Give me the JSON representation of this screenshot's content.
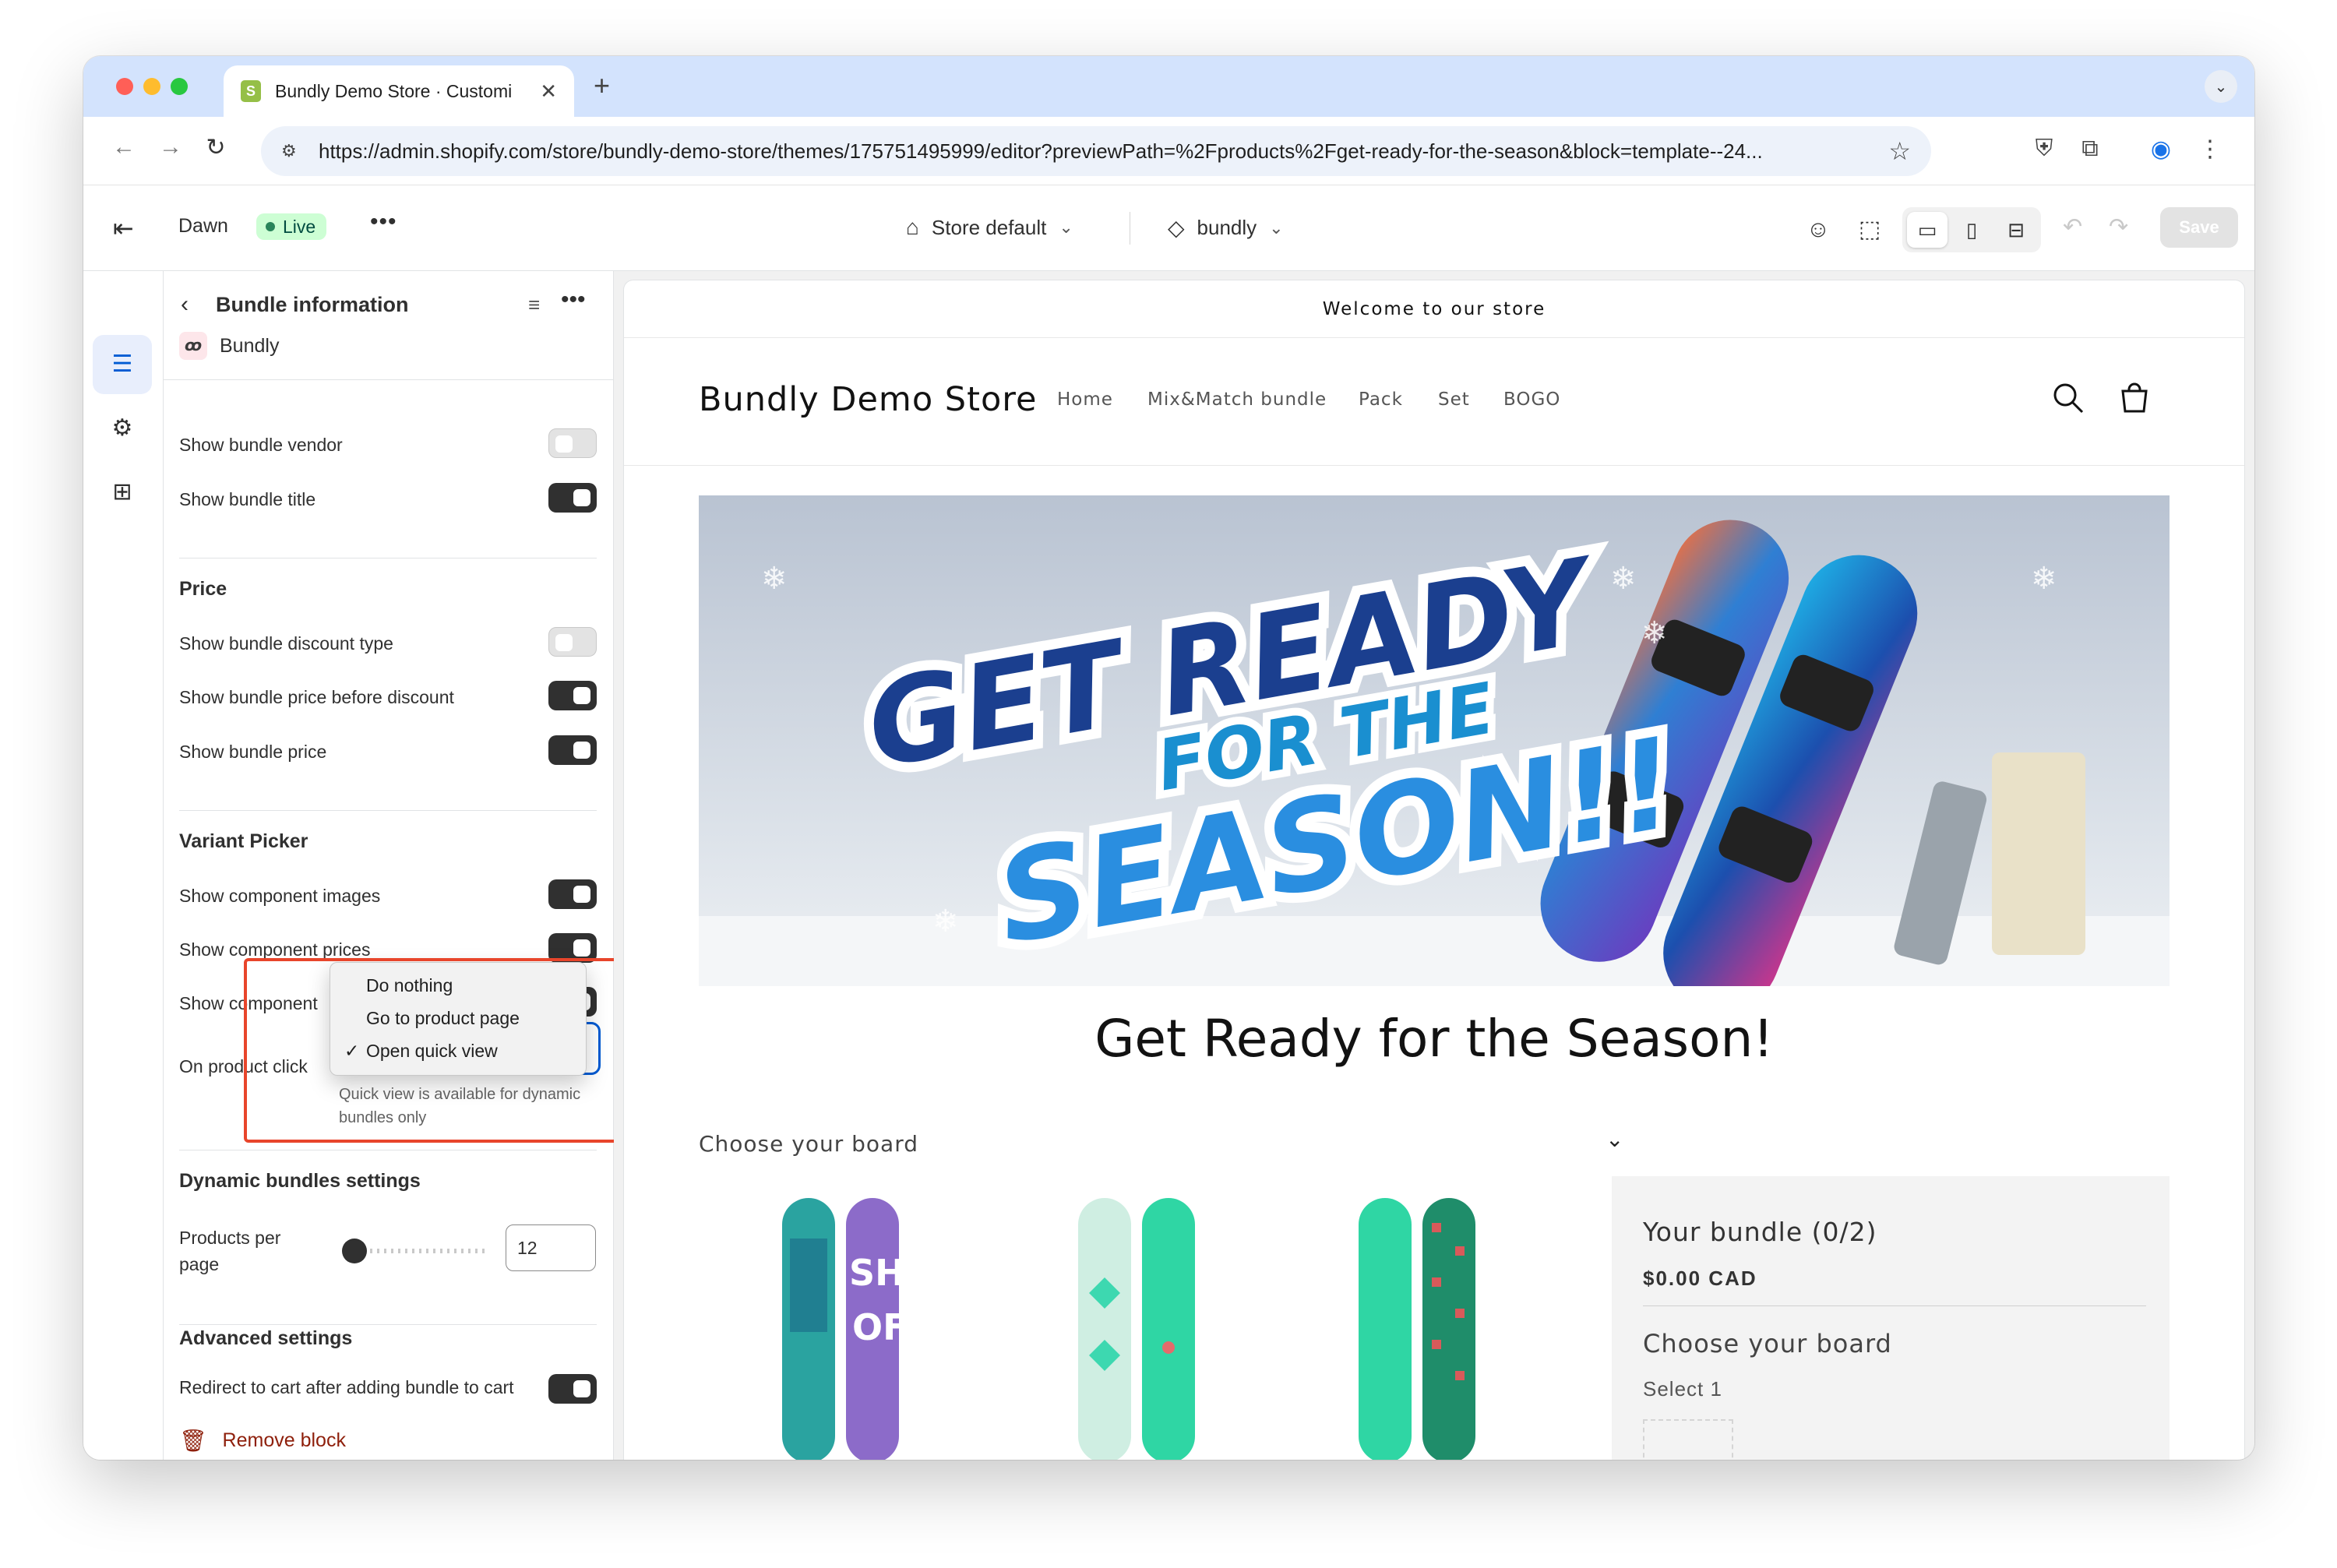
{
  "browser": {
    "tab_title": "Bundly Demo Store · Customi",
    "tab_favicon": "shopify-bag-icon",
    "url": "https://admin.shopify.com/store/bundly-demo-store/themes/175751495999/editor?previewPath=%2Fproducts%2Fget-ready-for-the-season&block=template--24..."
  },
  "editor": {
    "theme_name": "Dawn",
    "live_badge": "Live",
    "store_select": "Store default",
    "template_select": "bundly",
    "save_label": "Save"
  },
  "panel": {
    "title": "Bundle information",
    "app_name": "Bundly",
    "app_logo": "ꝏ",
    "rows_top": [
      {
        "label": "Show bundle vendor",
        "on": false
      },
      {
        "label": "Show bundle title",
        "on": true
      }
    ],
    "price_section": "Price",
    "price_rows": [
      {
        "label": "Show bundle discount type",
        "on": false
      },
      {
        "label": "Show bundle price before discount",
        "on": true
      },
      {
        "label": "Show bundle price",
        "on": true
      }
    ],
    "variant_section": "Variant Picker",
    "variant_rows": [
      {
        "label": "Show component images",
        "on": true
      },
      {
        "label": "Show component prices",
        "on": true
      },
      {
        "label": "Show component",
        "on": true
      }
    ],
    "on_product_click_label": "On product click",
    "dropdown_options": [
      "Do nothing",
      "Go to product page",
      "Open quick view"
    ],
    "dropdown_selected": "Open quick view",
    "help_text": "Quick view is available for dynamic bundles only",
    "dynamic_section": "Dynamic bundles settings",
    "products_per_page_label": "Products per page",
    "products_per_page_value": "12",
    "products_per_page_fraction": 0.0,
    "advanced_section": "Advanced settings",
    "redirect_label": "Redirect to cart after adding bundle to cart",
    "redirect_on": true,
    "remove_block": "Remove block"
  },
  "preview": {
    "announcement": "Welcome to our store",
    "store_name": "Bundly Demo Store",
    "nav": [
      "Home",
      "Mix&Match bundle",
      "Pack",
      "Set",
      "BOGO"
    ],
    "hero": {
      "line1": "GET READY",
      "line2": "FOR THE",
      "line3": "SEASON!!"
    },
    "product_title": "Get Ready for the Season!",
    "choose_board": "Choose your board",
    "bundle_title": "Your bundle (0/2)",
    "bundle_price": "$0.00 CAD",
    "bundle_sub": "Choose your board",
    "bundle_select": "Select 1"
  },
  "colors": {
    "accent_blue": "#005bd3",
    "highlight_red": "#e8452b",
    "live_green": "#cdfed4",
    "remove_red": "#8e1f0b"
  }
}
